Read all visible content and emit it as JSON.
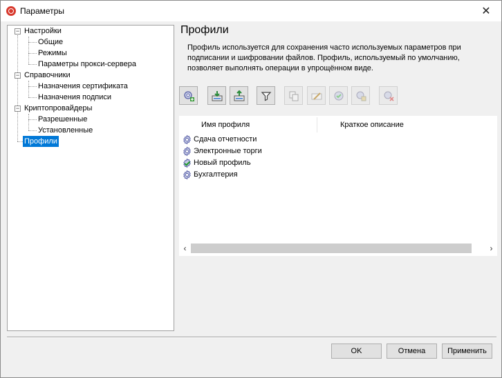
{
  "window": {
    "title": "Параметры",
    "close_glyph": "✕"
  },
  "tree": {
    "nodes": [
      {
        "label": "Настройки",
        "level": 0,
        "expanded": true
      },
      {
        "label": "Общие",
        "level": 1
      },
      {
        "label": "Режимы",
        "level": 1
      },
      {
        "label": "Параметры прокси-сервера",
        "level": 1
      },
      {
        "label": "Справочники",
        "level": 0,
        "expanded": true
      },
      {
        "label": "Назначения сертификата",
        "level": 1
      },
      {
        "label": "Назначения подписи",
        "level": 1
      },
      {
        "label": "Криптопровайдеры",
        "level": 0,
        "expanded": true
      },
      {
        "label": "Разрешенные",
        "level": 1
      },
      {
        "label": "Установленные",
        "level": 1
      },
      {
        "label": "Профили",
        "level": 0,
        "selected": true
      }
    ]
  },
  "panel": {
    "title": "Профили",
    "description": "Профиль используется для сохранения часто используемых параметров при подписании и шифровании файлов. Профиль, используемый по умолчанию, позволяет выполнять операции в упрощённом виде."
  },
  "toolbar": {
    "buttons": [
      {
        "icon": "add-profile-icon",
        "enabled": true
      },
      {
        "icon": "import-profile-icon",
        "enabled": true
      },
      {
        "icon": "export-profile-icon",
        "enabled": true
      },
      {
        "icon": "filter-icon",
        "enabled": true
      },
      {
        "icon": "copy-profile-icon",
        "enabled": false
      },
      {
        "icon": "rename-profile-icon",
        "enabled": false
      },
      {
        "icon": "set-default-profile-icon",
        "enabled": false
      },
      {
        "icon": "profile-properties-icon",
        "enabled": false
      },
      {
        "icon": "delete-profile-icon",
        "enabled": false
      }
    ]
  },
  "list": {
    "columns": [
      "Имя профиля",
      "Краткое описание"
    ],
    "items": [
      {
        "name": "Сдача отчетности",
        "default": false
      },
      {
        "name": "Электронные торги",
        "default": false
      },
      {
        "name": "Новый профиль",
        "default": true
      },
      {
        "name": "Бухгалтерия",
        "default": false
      }
    ],
    "scroll_left": "‹",
    "scroll_right": "›"
  },
  "buttons": {
    "ok": "OK",
    "cancel": "Отмена",
    "apply": "Применить"
  }
}
